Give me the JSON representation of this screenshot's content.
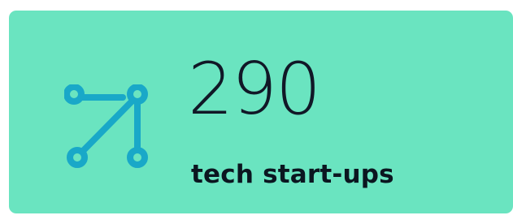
{
  "card": {
    "value": "290",
    "label": "tech start-ups",
    "icon": "network-nodes-icon",
    "background_color": "#6ae4c0",
    "icon_color": "#19a8c8"
  }
}
